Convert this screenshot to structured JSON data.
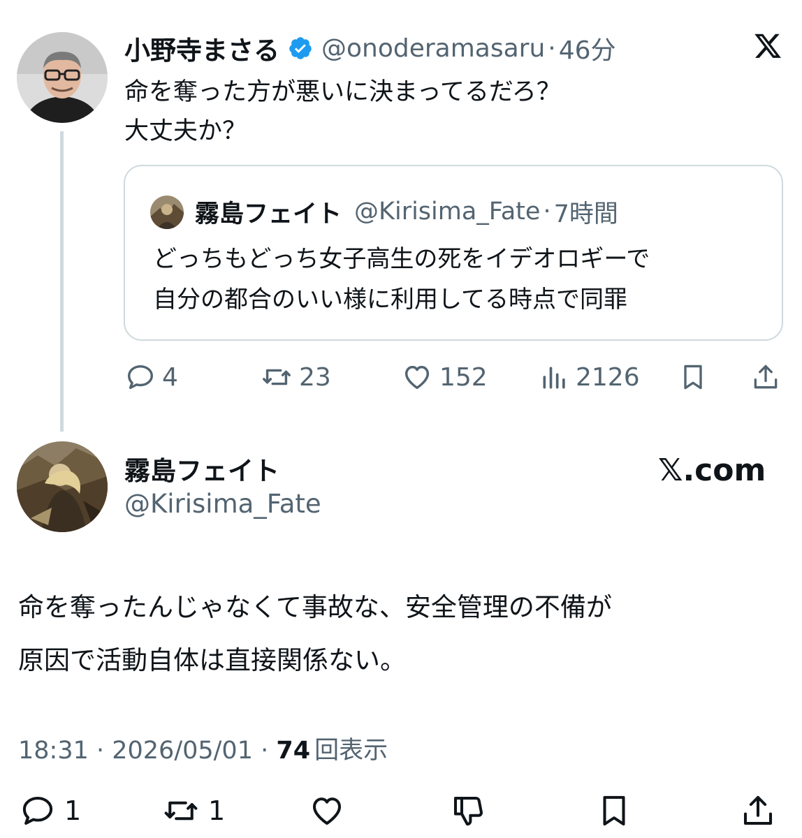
{
  "parent_tweet": {
    "author_name": "小野寺まさる",
    "verified": true,
    "handle": "@onoderamasaru",
    "separator": "·",
    "time": "46分",
    "text_lines": [
      "命を奪った方が悪いに決まってるだろ？",
      "大丈夫か？"
    ],
    "quote": {
      "author_name": "霧島フェイト",
      "handle": "@Kirisima_Fate",
      "separator": "·",
      "time": "7時間",
      "text_lines": [
        "どっちもどっち女子高生の死をイデオロギーで",
        "自分の都合のいい様に利用してる時点で同罪"
      ]
    },
    "actions": {
      "replies": "4",
      "retweets": "23",
      "likes": "152",
      "views": "2126"
    }
  },
  "reply_tweet": {
    "author_name": "霧島フェイト",
    "handle": "@Kirisima_Fate",
    "brand": "𝕏.com",
    "text_lines": [
      "命を奪ったんじゃなくて事故な、安全管理の不備が",
      "原因で活動自体は直接関係ない。"
    ],
    "timestamp": "18:31 · 2026/05/01 · ",
    "views_count": "74",
    "views_label": "回表示",
    "actions": {
      "replies": "1",
      "retweets": "1"
    }
  },
  "icons": [
    "x-logo-icon",
    "verified-badge-icon",
    "reply-icon",
    "retweet-icon",
    "like-icon",
    "views-icon",
    "bookmark-icon",
    "share-icon",
    "dislike-icon"
  ],
  "colors": {
    "verified": "#1d9bf0",
    "text": "#0f1419",
    "secondary": "#536471",
    "thread_line": "#cfd9de",
    "border": "#cfd9de"
  }
}
